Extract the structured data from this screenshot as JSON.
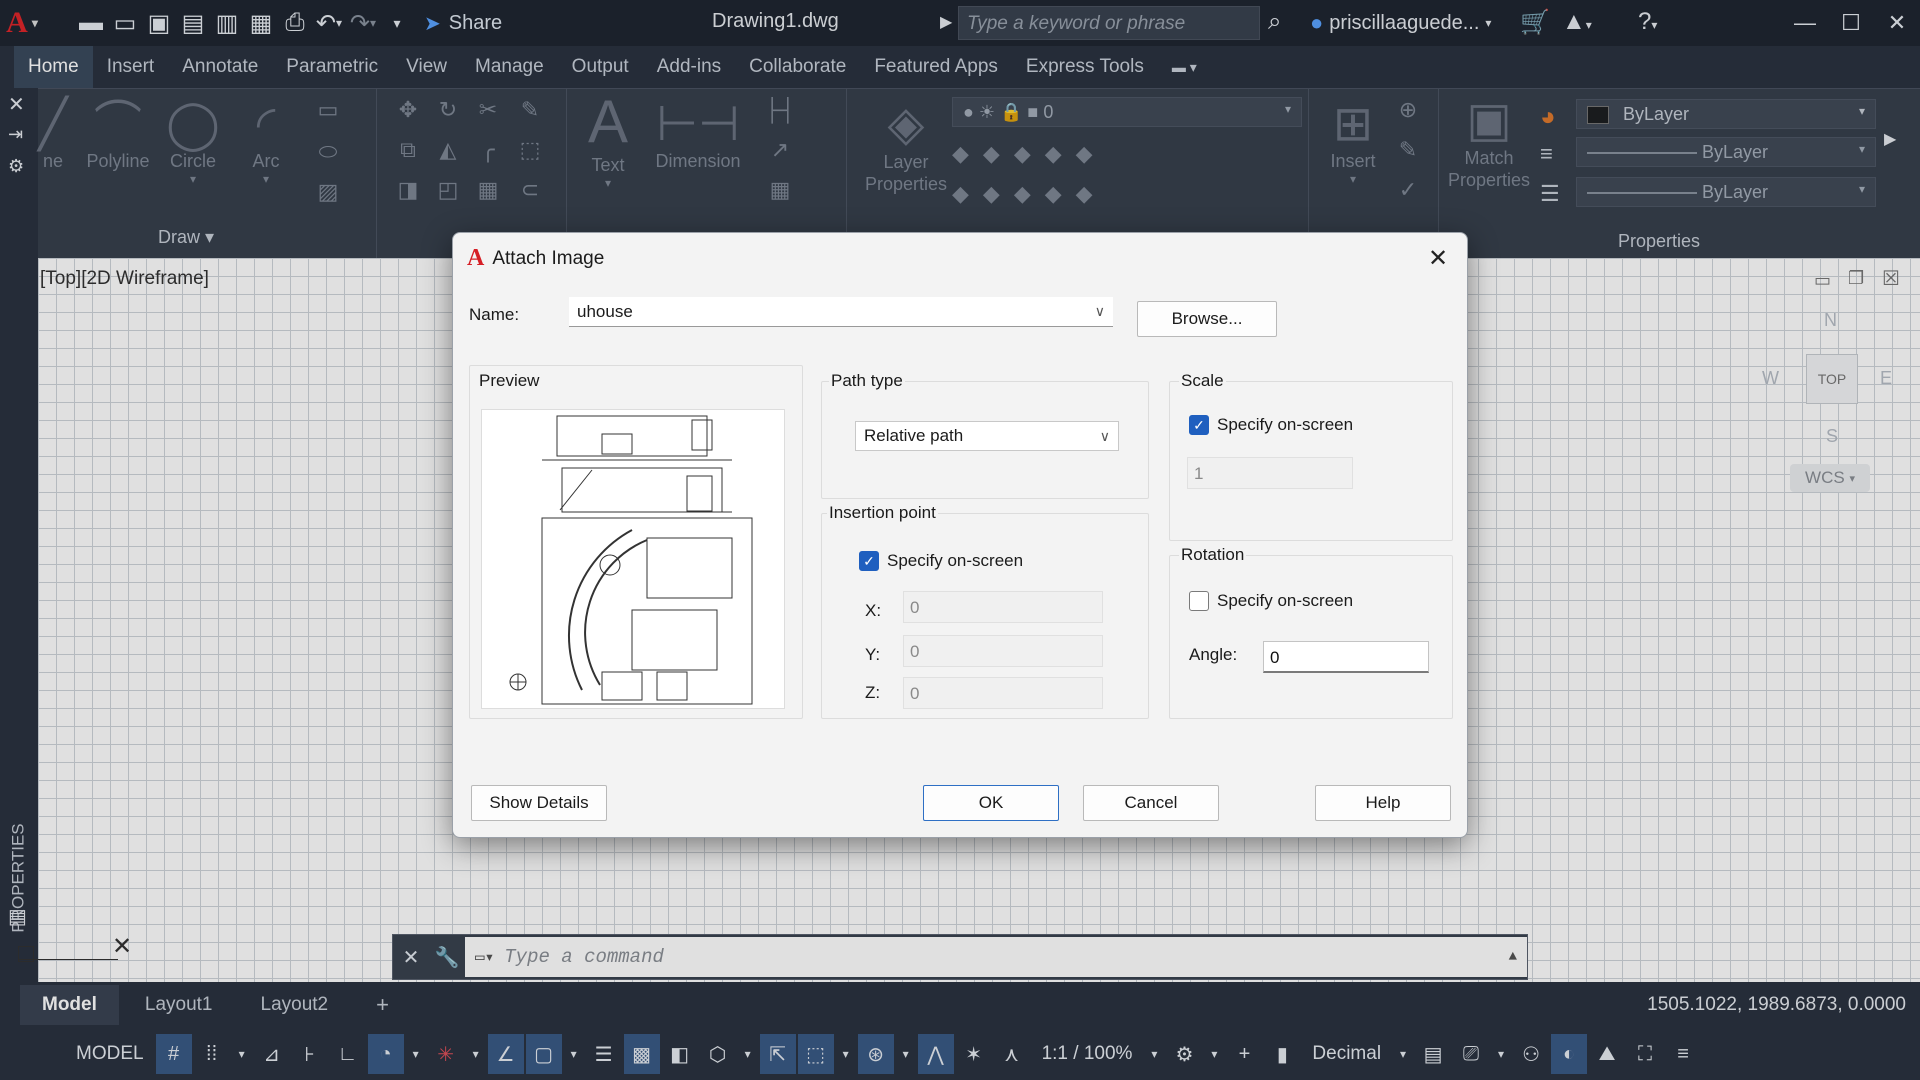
{
  "titlebar": {
    "share_label": "Share",
    "document_title": "Drawing1.dwg",
    "search_placeholder": "Type a keyword or phrase",
    "username": "priscillaaguede..."
  },
  "tabs": [
    "Home",
    "Insert",
    "Annotate",
    "Parametric",
    "View",
    "Manage",
    "Output",
    "Add-ins",
    "Collaborate",
    "Featured Apps",
    "Express Tools"
  ],
  "ribbon": {
    "draw_tools": {
      "partial": "ne",
      "polyline": "Polyline",
      "circle": "Circle",
      "arc": "Arc"
    },
    "draw_panel": "Draw",
    "text": "Text",
    "dimension": "Dimension",
    "layer_properties": "Layer Properties",
    "layer_value": "0",
    "insert": "Insert",
    "match_properties": "Match Properties",
    "bylayer": "ByLayer",
    "properties_panel": "Properties"
  },
  "view_label": "[Top][2D Wireframe]",
  "viewcube": {
    "n": "N",
    "w": "W",
    "e": "E",
    "s": "S",
    "top": "TOP",
    "wcs": "WCS"
  },
  "properties_palette_label": "PROPERTIES",
  "command_line": {
    "placeholder": "Type a command"
  },
  "layout_tabs": [
    "Model",
    "Layout1",
    "Layout2"
  ],
  "coordinates": "1505.1022, 1989.6873, 0.0000",
  "statusbar": {
    "model": "MODEL",
    "scale": "1:1 / 100%",
    "units": "Decimal"
  },
  "dialog": {
    "title": "Attach Image",
    "name_label": "Name:",
    "name_value": "uhouse",
    "browse_label": "Browse...",
    "preview_label": "Preview",
    "path_type_label": "Path type",
    "path_type_value": "Relative path",
    "scale_label": "Scale",
    "scale_specify": "Specify on-screen",
    "scale_value": "1",
    "insertion_label": "Insertion point",
    "insertion_specify": "Specify on-screen",
    "x_label": "X:",
    "x_value": "0",
    "y_label": "Y:",
    "y_value": "0",
    "z_label": "Z:",
    "z_value": "0",
    "rotation_label": "Rotation",
    "rotation_specify": "Specify on-screen",
    "angle_label": "Angle:",
    "angle_value": "0",
    "show_details": "Show Details",
    "ok": "OK",
    "cancel": "Cancel",
    "help": "Help",
    "scale_checked": true,
    "insertion_checked": true,
    "rotation_checked": false
  }
}
